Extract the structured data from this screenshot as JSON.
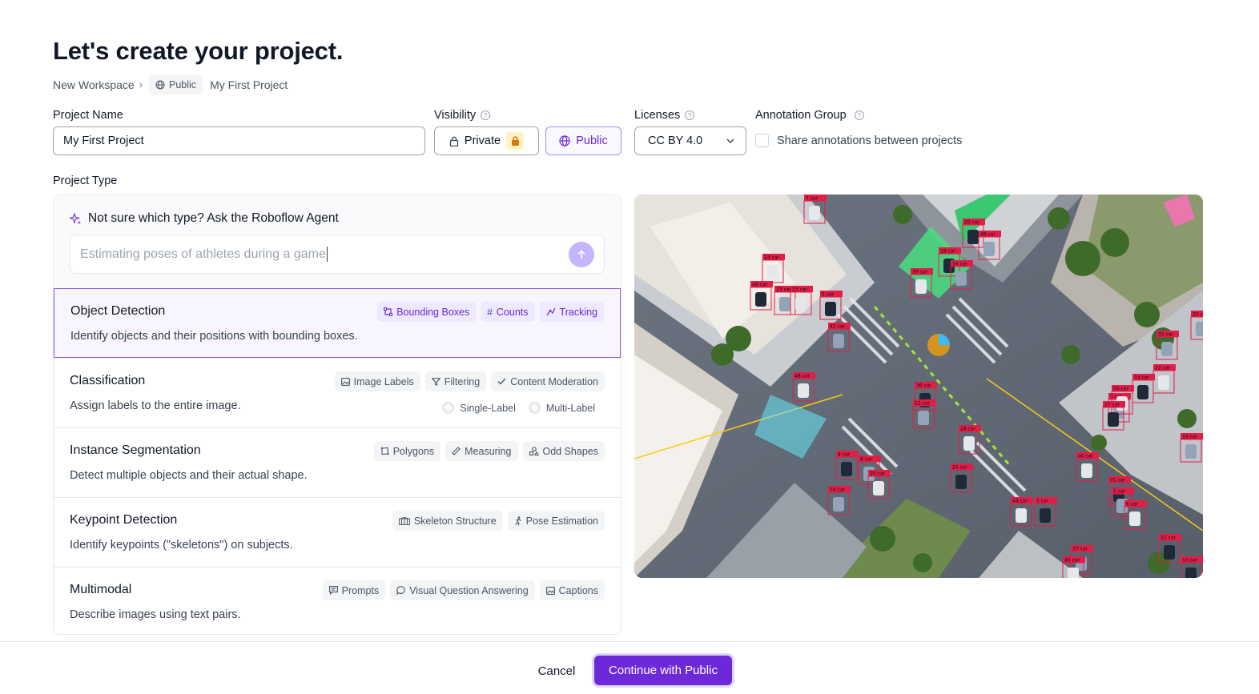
{
  "page": {
    "title": "Let's create your project."
  },
  "breadcrumb": {
    "workspace": "New Workspace",
    "visibility_badge": "Public",
    "project": "My First Project"
  },
  "project_name": {
    "label": "Project Name",
    "value": "My First Project"
  },
  "visibility": {
    "label": "Visibility",
    "private_label": "Private",
    "public_label": "Public",
    "selected": "Public"
  },
  "licenses": {
    "label": "Licenses",
    "value": "CC BY 4.0"
  },
  "annotation_group": {
    "label": "Annotation Group",
    "checkbox_label": "Share annotations between projects",
    "checked": false
  },
  "project_type": {
    "label": "Project Type",
    "agent": {
      "title": "Not sure which type? Ask the Roboflow Agent",
      "input_value": "Estimating poses of athletes during a game"
    },
    "types": [
      {
        "name": "Object Detection",
        "description": "Identify objects and their positions with bounding boxes.",
        "selected": true,
        "tags": [
          "Bounding Boxes",
          "Counts",
          "Tracking"
        ]
      },
      {
        "name": "Classification",
        "description": "Assign labels to the entire image.",
        "selected": false,
        "tags": [
          "Image Labels",
          "Filtering",
          "Content Moderation"
        ],
        "options": [
          "Single-Label",
          "Multi-Label"
        ]
      },
      {
        "name": "Instance Segmentation",
        "description": "Detect multiple objects and their actual shape.",
        "selected": false,
        "tags": [
          "Polygons",
          "Measuring",
          "Odd Shapes"
        ]
      },
      {
        "name": "Keypoint Detection",
        "description": "Identify keypoints (\"skeletons\") on subjects.",
        "selected": false,
        "tags": [
          "Skeleton Structure",
          "Pose Estimation"
        ]
      },
      {
        "name": "Multimodal",
        "description": "Describe images using text pairs.",
        "selected": false,
        "tags": [
          "Prompts",
          "Visual Question Answering",
          "Captions"
        ]
      }
    ]
  },
  "preview": {
    "annotation_labels": [
      "7 car",
      "20 car",
      "46 car",
      "24 car",
      "18 car",
      "16 car",
      "39 car",
      "49 car",
      "13 car",
      "33 car",
      "5 car",
      "41 car",
      "48 car",
      "36 car",
      "12 car",
      "28 car",
      "4 car",
      "8 car",
      "20 car",
      "25 car",
      "34 car",
      "44 car",
      "1 car",
      "35 car",
      "22 car",
      "14 car",
      "3 car",
      "50 car",
      "27 car",
      "19 car",
      "40 car",
      "31 car",
      "1 car",
      "6 car",
      "21 car",
      "37 car",
      "45 car",
      "10 car",
      "23 car"
    ]
  },
  "footer": {
    "cancel_label": "Cancel",
    "continue_label": "Continue with Public"
  },
  "colors": {
    "accent": "#6d28d9",
    "accent_light": "#ede9fe",
    "box_label": "#e11d48"
  }
}
